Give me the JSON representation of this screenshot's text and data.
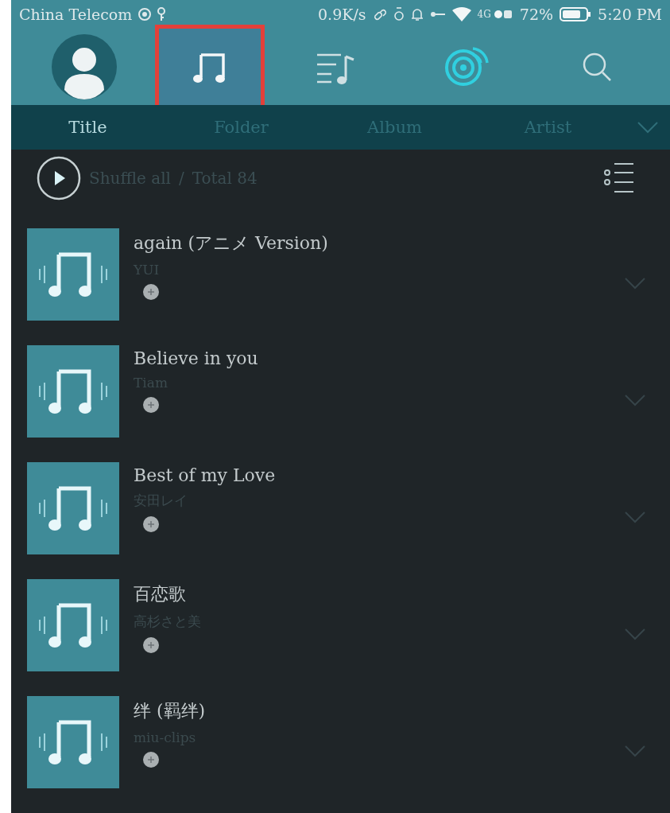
{
  "status_bar": {
    "carrier": "China Telecom",
    "speed": "0.9K/s",
    "network": "4G",
    "battery": "72%",
    "time": "5:20 PM"
  },
  "nav": [
    {
      "kind": "avatar",
      "selected": false,
      "highlighted": false
    },
    {
      "kind": "songs",
      "selected": true,
      "highlighted": true
    },
    {
      "kind": "playlist",
      "selected": false,
      "highlighted": false
    },
    {
      "kind": "radio",
      "selected": false,
      "highlighted": false
    },
    {
      "kind": "search",
      "selected": false,
      "highlighted": false
    }
  ],
  "tabs": [
    {
      "label": "Title",
      "selected": true
    },
    {
      "label": "Folder",
      "selected": false
    },
    {
      "label": "Album",
      "selected": false
    },
    {
      "label": "Artist",
      "selected": false
    }
  ],
  "shuffle": {
    "label": "Shuffle all",
    "separator": "/",
    "total": "Total 84"
  },
  "songs": [
    {
      "title": "again (アニメ Version)",
      "artist": "YUI"
    },
    {
      "title": "Believe in you",
      "artist": "Tiam"
    },
    {
      "title": "Best of my Love",
      "artist": "安田レイ"
    },
    {
      "title": "百恋歌",
      "artist": "高杉さと美"
    },
    {
      "title": "绊 (羁绊)",
      "artist": "miu-clips"
    }
  ]
}
